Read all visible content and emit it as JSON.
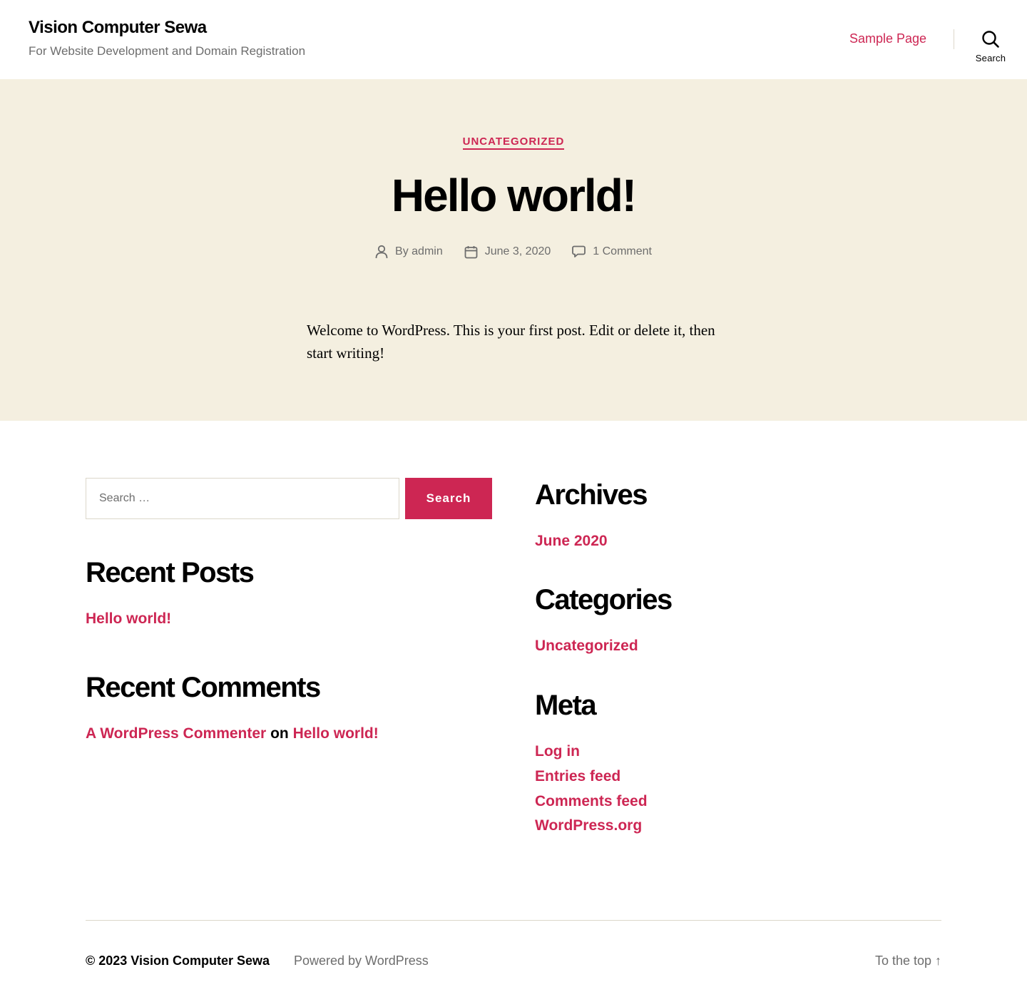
{
  "header": {
    "site_title": "Vision Computer Sewa",
    "site_description": "For Website Development and Domain Registration",
    "nav_link": "Sample Page",
    "search_label": "Search",
    "icon": "search-icon"
  },
  "post": {
    "category": "UNCATEGORIZED",
    "title": "Hello world!",
    "meta": {
      "author_prefix": "By",
      "author": "admin",
      "date": "June 3, 2020",
      "comments": "1 Comment"
    },
    "content": "Welcome to WordPress. This is your first post. Edit or delete it, then start writing!"
  },
  "widgets": {
    "search": {
      "placeholder": "Search …",
      "button_label": "Search"
    },
    "recent_posts": {
      "title": "Recent Posts",
      "items": [
        "Hello world!"
      ]
    },
    "recent_comments": {
      "title": "Recent Comments",
      "author": "A WordPress Commenter",
      "connector": "on",
      "post": "Hello world!"
    },
    "archives": {
      "title": "Archives",
      "items": [
        "June 2020"
      ]
    },
    "categories": {
      "title": "Categories",
      "items": [
        "Uncategorized"
      ]
    },
    "meta": {
      "title": "Meta",
      "items": [
        "Log in",
        "Entries feed",
        "Comments feed",
        "WordPress.org"
      ]
    }
  },
  "footer": {
    "copyright": "© 2023 Vision Computer Sewa",
    "powered_by": "Powered by WordPress",
    "to_top": "To the top ↑"
  },
  "colors": {
    "accent": "#cd2653",
    "band_background": "#f4efe0",
    "muted_text": "#6d6d6d"
  }
}
